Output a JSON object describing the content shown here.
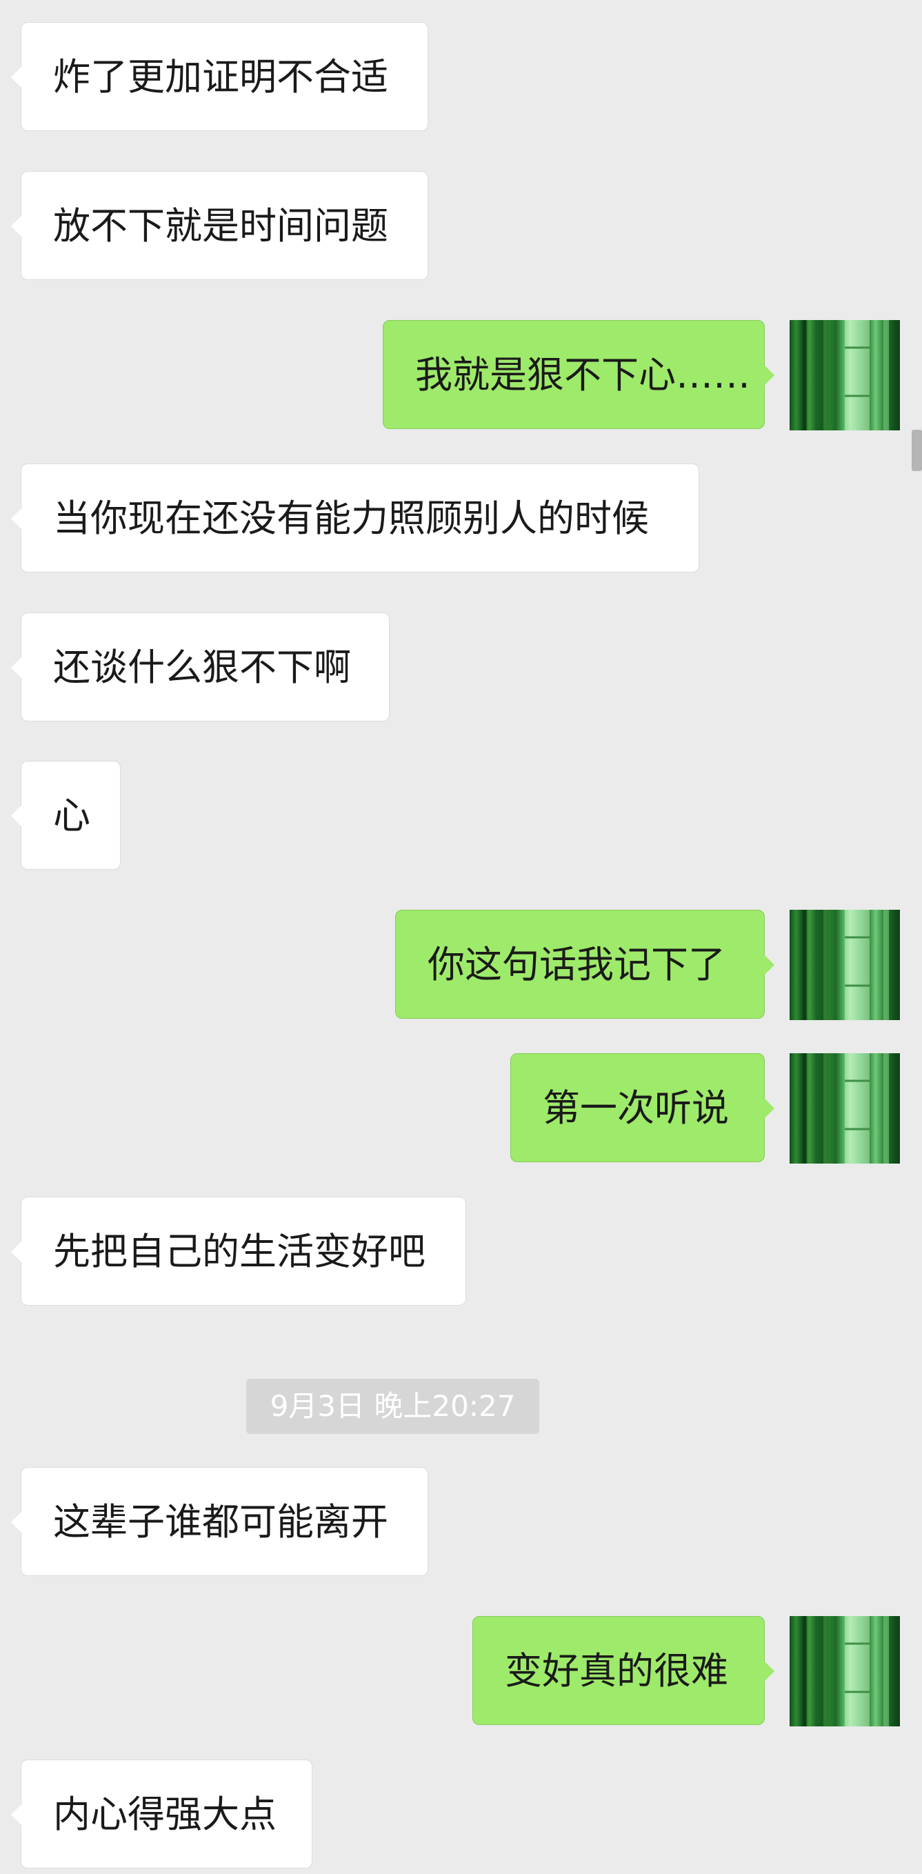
{
  "messages": [
    {
      "side": "in",
      "text": "炸了更加证明不合适"
    },
    {
      "side": "in",
      "text": "放不下就是时间问题"
    },
    {
      "side": "out",
      "text": "我就是狠不下心……"
    },
    {
      "side": "in",
      "text": "当你现在还没有能力照顾别人的时候"
    },
    {
      "side": "in",
      "text": "还谈什么狠不下啊"
    },
    {
      "side": "in",
      "text": "心"
    },
    {
      "side": "out",
      "text": "你这句话我记下了"
    },
    {
      "side": "out",
      "text": "第一次听说"
    },
    {
      "side": "in",
      "text": "先把自己的生活变好吧"
    },
    {
      "side": "in",
      "text": "这辈子谁都可能离开"
    },
    {
      "side": "out",
      "text": "变好真的很难"
    },
    {
      "side": "in",
      "text": "内心得强大点"
    }
  ],
  "timestamp": "9月3日 晚上20:27",
  "colors": {
    "background": "#ebebeb",
    "incoming_bubble": "#ffffff",
    "outgoing_bubble": "#9eea6a",
    "timestamp_bg": "#d6d6d6"
  },
  "avatar_icon": "bamboo-avatar-icon"
}
